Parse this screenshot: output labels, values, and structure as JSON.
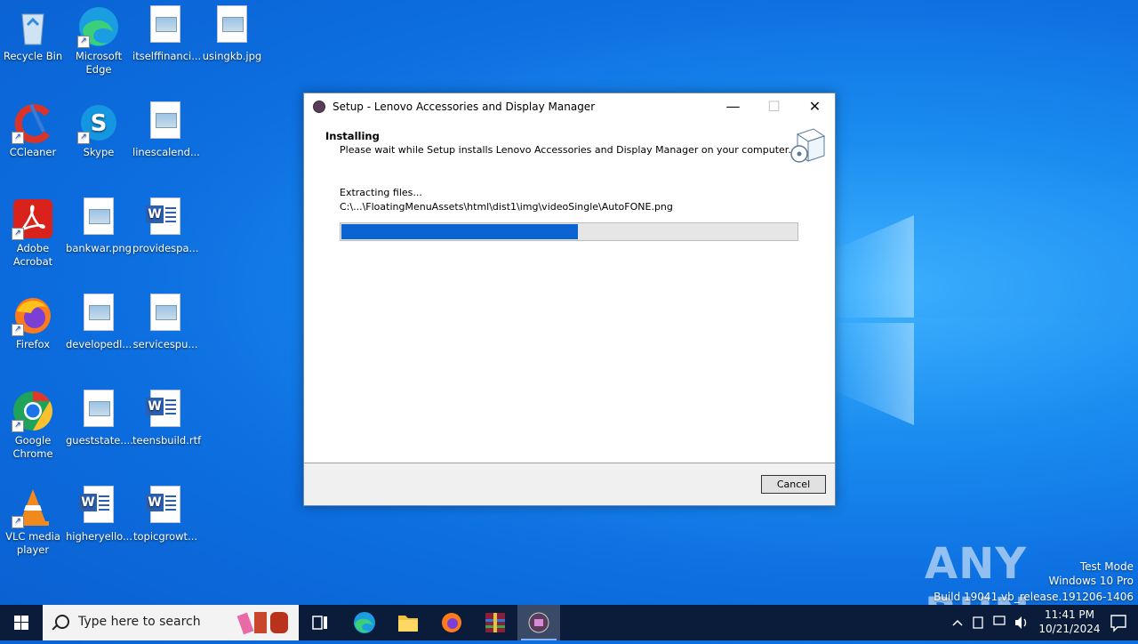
{
  "desktop": {
    "icons": [
      {
        "label": "Recycle Bin",
        "icon": "recycle-bin-icon"
      },
      {
        "label": "Microsoft Edge",
        "icon": "edge-icon"
      },
      {
        "label": "itselffinanci...",
        "icon": "image-file-icon"
      },
      {
        "label": "usingkb.jpg",
        "icon": "image-file-icon"
      },
      {
        "label": "CCleaner",
        "icon": "ccleaner-icon"
      },
      {
        "label": "Skype",
        "icon": "skype-icon"
      },
      {
        "label": "linescalend...",
        "icon": "image-file-icon"
      },
      {
        "label": "Adobe Acrobat",
        "icon": "acrobat-icon"
      },
      {
        "label": "bankwar.png",
        "icon": "image-file-icon"
      },
      {
        "label": "providespa...",
        "icon": "word-file-icon"
      },
      {
        "label": "Firefox",
        "icon": "firefox-icon"
      },
      {
        "label": "developedl...",
        "icon": "image-file-icon"
      },
      {
        "label": "servicespu...",
        "icon": "image-file-icon"
      },
      {
        "label": "Google Chrome",
        "icon": "chrome-icon"
      },
      {
        "label": "gueststate....",
        "icon": "image-file-icon"
      },
      {
        "label": "teensbuild.rtf",
        "icon": "word-file-icon"
      },
      {
        "label": "VLC media player",
        "icon": "vlc-icon"
      },
      {
        "label": "higheryello...",
        "icon": "word-file-icon"
      },
      {
        "label": "topicgrowt...",
        "icon": "word-file-icon"
      }
    ]
  },
  "setup": {
    "title": "Setup - Lenovo Accessories and Display Manager",
    "minimize": "—",
    "maximize": "☐",
    "close": "✕",
    "heading": "Installing",
    "subheading": "Please wait while Setup installs Lenovo Accessories and Display Manager on your computer.",
    "status": "Extracting files...",
    "file_path": "C:\\...\\FloatingMenuAssets\\html\\dist1\\img\\videoSingle\\AutoFONE.png",
    "progress": 0.52,
    "cancel_label": "Cancel"
  },
  "watermark": {
    "brand": "ANY RUN",
    "test_mode": "Test Mode",
    "edition": "Windows 10 Pro",
    "build": "Build 19041.vb_release.191206-1406"
  },
  "taskbar": {
    "search_placeholder": "Type here to search",
    "time": "11:41 PM",
    "date": "10/21/2024"
  },
  "colors": {
    "accent": "#0a64d2",
    "taskbar": "#0b1b3a"
  }
}
